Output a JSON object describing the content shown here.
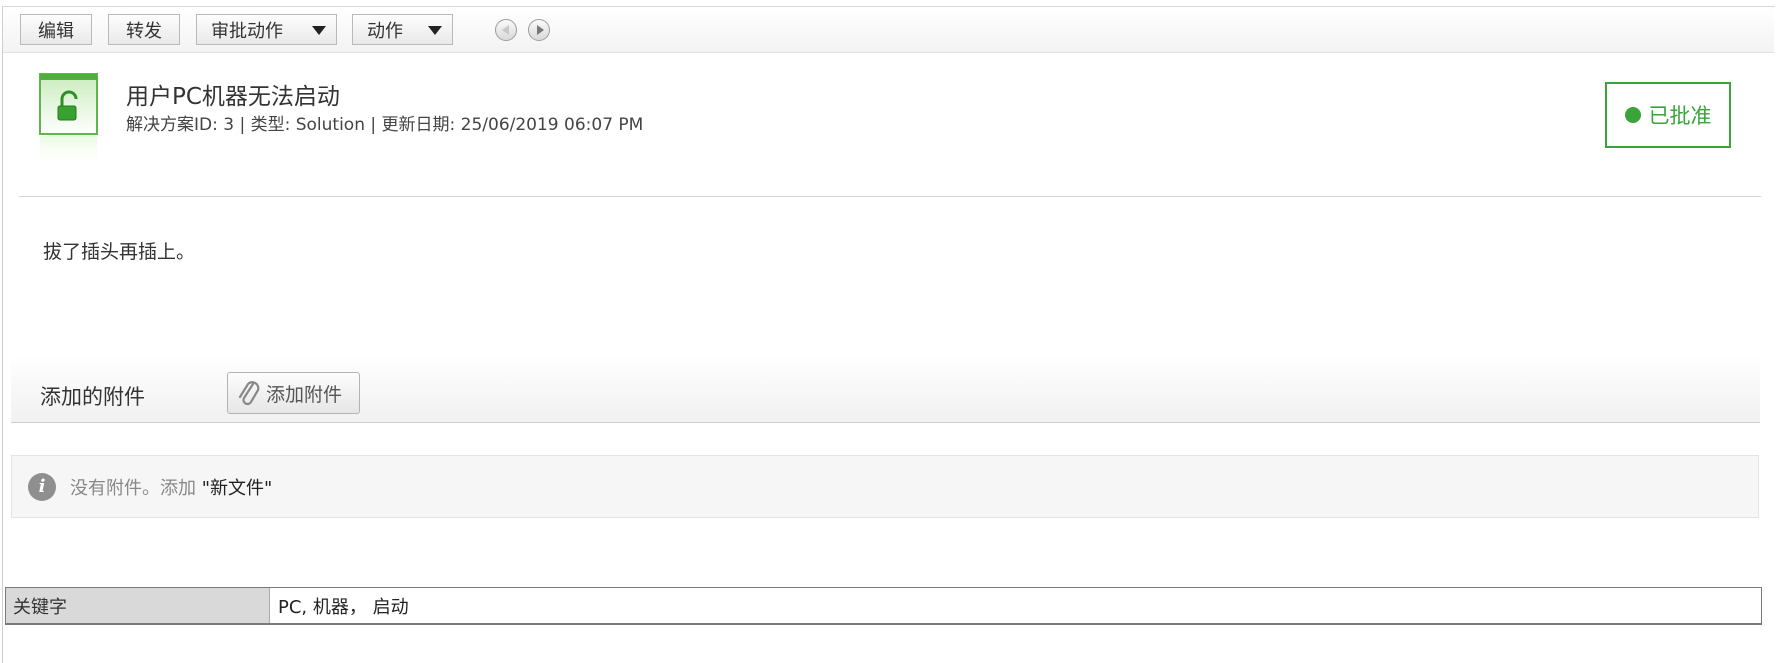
{
  "toolbar": {
    "edit_label": "编辑",
    "forward_label": "转发",
    "approval_actions_label": "审批动作",
    "actions_label": "动作"
  },
  "solution": {
    "title": "用户PC机器无法启动",
    "meta": "解决方案ID: 3 | 类型: Solution | 更新日期: 25/06/2019 06:07 PM",
    "status": "已批准",
    "status_color": "#3aa33a",
    "body": "拔了插头再插上。"
  },
  "attachments": {
    "title": "添加的附件",
    "add_button_label": "添加附件",
    "empty_message": "没有附件。添加",
    "new_file_link": "\"新文件\""
  },
  "keywords": {
    "label": "关键字",
    "value": "PC, 机器， 启动"
  }
}
